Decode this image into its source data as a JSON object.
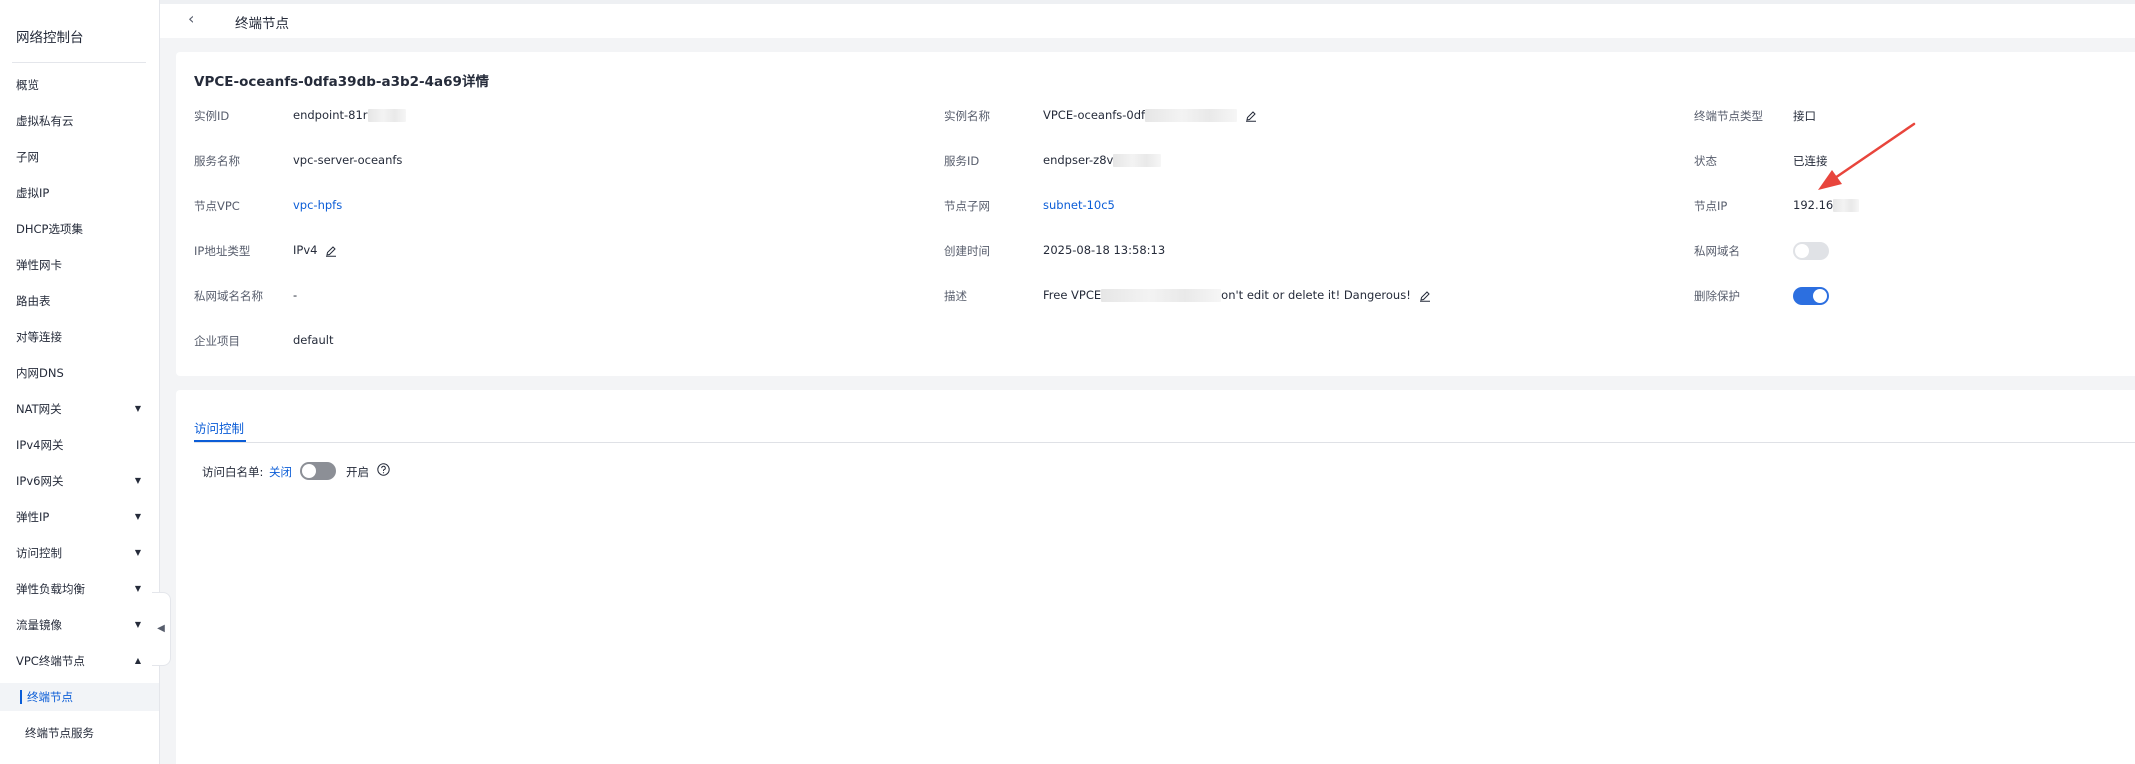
{
  "sidebar": {
    "title": "网络控制台",
    "items": [
      {
        "label": "概览"
      },
      {
        "label": "虚拟私有云"
      },
      {
        "label": "子网"
      },
      {
        "label": "虚拟IP"
      },
      {
        "label": "DHCP选项集"
      },
      {
        "label": "弹性网卡"
      },
      {
        "label": "路由表"
      },
      {
        "label": "对等连接"
      },
      {
        "label": "内网DNS"
      },
      {
        "label": "NAT网关",
        "expandable": true
      },
      {
        "label": "IPv4网关"
      },
      {
        "label": "IPv6网关",
        "expandable": true
      },
      {
        "label": "弹性IP",
        "expandable": true
      },
      {
        "label": "访问控制",
        "expandable": true
      },
      {
        "label": "弹性负载均衡",
        "expandable": true
      },
      {
        "label": "流量镜像",
        "expandable": true
      },
      {
        "label": "VPC终端节点",
        "expanded": true
      },
      {
        "label": "终端节点",
        "active": true
      },
      {
        "label": "终端节点服务"
      }
    ],
    "caret_down": "▼",
    "caret_up": "▲",
    "collapse_glyph": "◀"
  },
  "header": {
    "back_glyph": "‹",
    "title": "终端节点"
  },
  "detail": {
    "title": "VPCE-oceanfs-0dfa39db-a3b2-4a69详情",
    "fields": {
      "instance_id": {
        "label": "实例ID",
        "value": "endpoint-81r"
      },
      "instance_name": {
        "label": "实例名称",
        "value": "VPCE-oceanfs-0df"
      },
      "endpoint_type": {
        "label": "终端节点类型",
        "value": "接口"
      },
      "service_name": {
        "label": "服务名称",
        "value": "vpc-server-oceanfs"
      },
      "service_id": {
        "label": "服务ID",
        "value": "endpser-z8v"
      },
      "status": {
        "label": "状态",
        "value": "已连接"
      },
      "node_vpc": {
        "label": "节点VPC",
        "value": "vpc-hpfs"
      },
      "node_subnet": {
        "label": "节点子网",
        "value": "subnet-10c5"
      },
      "node_ip": {
        "label": "节点IP",
        "value": "192.16"
      },
      "ip_type": {
        "label": "IP地址类型",
        "value": "IPv4"
      },
      "created": {
        "label": "创建时间",
        "value": "2025-08-18 13:58:13"
      },
      "private_dns": {
        "label": "私网域名",
        "enabled": false
      },
      "private_dns_name": {
        "label": "私网域名名称",
        "value": "-"
      },
      "description": {
        "label": "描述",
        "value_prefix": "Free VPCE",
        "value_suffix": "on't edit or delete it! Dangerous!"
      },
      "delete_protection": {
        "label": "删除保护",
        "enabled": true
      },
      "enterprise_project": {
        "label": "企业项目",
        "value": "default"
      }
    }
  },
  "access": {
    "tab": "访问控制",
    "whitelist_label": "访问白名单:",
    "off_label": "关闭",
    "on_label": "开启",
    "whitelist_enabled": false
  },
  "colors": {
    "accent": "#0b5dd7",
    "arrow": "#e8453c",
    "toggle_on": "#2c6fe0"
  }
}
